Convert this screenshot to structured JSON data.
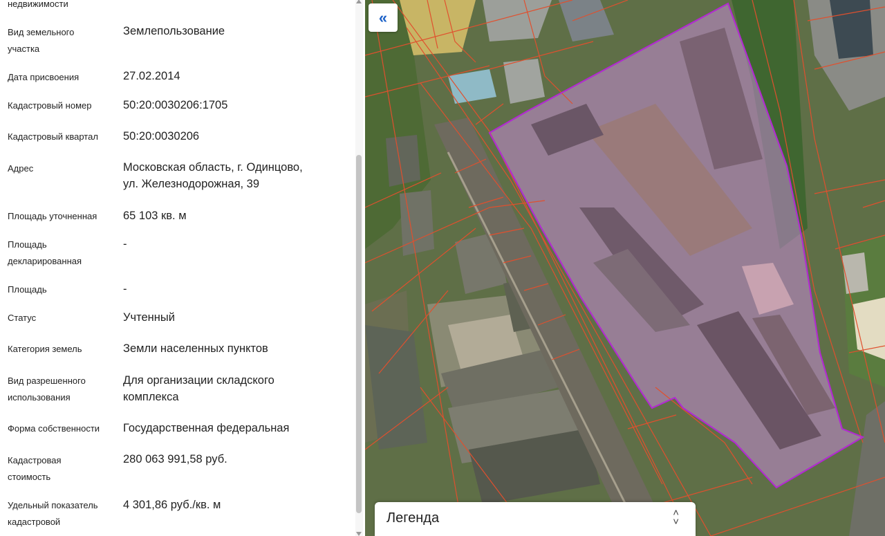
{
  "panel": {
    "cut_heading": "недвижимости",
    "rows": [
      {
        "label": "Вид земельного\nучастка",
        "value": "Землепользование"
      },
      {
        "label": "Дата присвоения",
        "value": "27.02.2014"
      },
      {
        "label": "Кадастровый номер",
        "value": "50:20:0030206:1705"
      },
      {
        "label": "Кадастровый квартал",
        "value": "50:20:0030206"
      },
      {
        "label": "Адрес",
        "value": "Московская область, г. Одинцово,\nул. Железнодорожная, 39"
      },
      {
        "label": "Площадь уточненная",
        "value": "65 103 кв. м"
      },
      {
        "label": "Площадь\nдекларированная",
        "value": "-"
      },
      {
        "label": "Площадь",
        "value": "-"
      },
      {
        "label": "Статус",
        "value": "Учтенный"
      },
      {
        "label": "Категория земель",
        "value": "Земли населенных пунктов"
      },
      {
        "label": "Вид разрешенного\nиспользования",
        "value": "Для организации складского\nкомплекса"
      },
      {
        "label": "Форма собственности",
        "value": "Государственная федеральная"
      },
      {
        "label": "Кадастровая\nстоимость",
        "value": "280 063 991,58 руб."
      },
      {
        "label": "Удельный показатель\nкадастровой",
        "value": "4 301,86 руб./кв. м"
      }
    ]
  },
  "map": {
    "collapse_icon": "«",
    "legend_label": "Легенда",
    "legend_toggle_icon": "up-down-chevron",
    "colors": {
      "parcel_border": "#e0502e",
      "selected_border": "#b12bd0",
      "selected_fill": "#c48ad6"
    }
  }
}
